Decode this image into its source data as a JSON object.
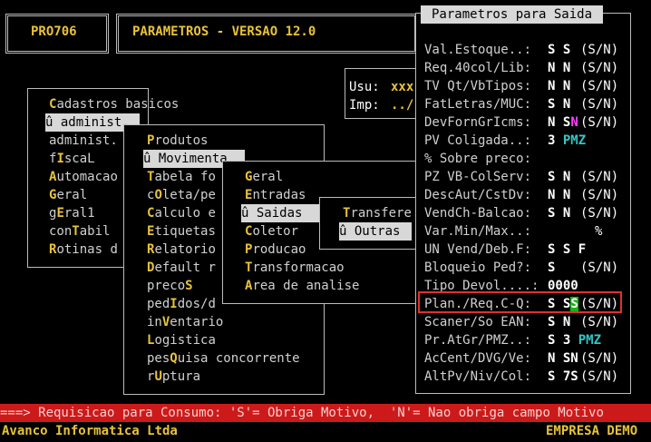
{
  "header": {
    "code": "PRO706",
    "title": "PARAMETROS - VERSAO 12.0"
  },
  "user_box": {
    "usu_label": "Usu:",
    "usu_value": "xxx",
    "imp_label": "Imp:",
    "imp_value": "../"
  },
  "menu1": {
    "items": [
      {
        "hot": "C",
        "rest": "adastros basicos"
      },
      {
        "prefix": "û ",
        "text": "administ.",
        "selected": true
      },
      {
        "text": "administ."
      },
      {
        "pre": "f",
        "hot": "I",
        "rest": "scaL"
      },
      {
        "hot": "A",
        "rest": "utomacao"
      },
      {
        "hot": "G",
        "rest": "eral"
      },
      {
        "pre": "g",
        "hot": "E",
        "rest": "ral1"
      },
      {
        "pre": "con",
        "hot": "T",
        "rest": "abil"
      },
      {
        "hot": "R",
        "rest": "otinas d"
      }
    ]
  },
  "menu2": {
    "items": [
      {
        "hot": "P",
        "rest": "rodutos"
      },
      {
        "prefix": "û ",
        "text": "Movimenta",
        "selected": true
      },
      {
        "hot": "T",
        "rest": "abela fo"
      },
      {
        "pre": "c",
        "hot": "O",
        "rest": "leta/pe"
      },
      {
        "hot": "C",
        "rest": "alculo e"
      },
      {
        "hot": "E",
        "rest": "tiquetas"
      },
      {
        "hot": "R",
        "rest": "elatorio"
      },
      {
        "hot": "D",
        "rest": "efault r"
      },
      {
        "pre": "preco",
        "hot": "S",
        "rest": ""
      },
      {
        "pre": "ped",
        "hot": "I",
        "rest": "dos/d"
      },
      {
        "pre": "in",
        "hot": "V",
        "rest": "entario"
      },
      {
        "hot": "L",
        "rest": "ogistica"
      },
      {
        "pre": "pes",
        "hot": "Q",
        "rest": "uisa concorrente"
      },
      {
        "pre": "r",
        "hot": "U",
        "rest": "ptura"
      }
    ]
  },
  "menu3": {
    "items": [
      {
        "hot": "G",
        "rest": "eral"
      },
      {
        "hot": "E",
        "rest": "ntradas"
      },
      {
        "prefix": "û ",
        "text": "Saidas",
        "selected": true
      },
      {
        "hot": "C",
        "rest": "oletor"
      },
      {
        "hot": "P",
        "rest": "roducao"
      },
      {
        "hot": "T",
        "rest": "ransformacao"
      },
      {
        "hot": "A",
        "rest": "rea de analise"
      }
    ]
  },
  "menu4": {
    "items": [
      {
        "hot": "T",
        "rest": "ransfere"
      },
      {
        "prefix": "û ",
        "text": "Outras",
        "selected": true
      }
    ]
  },
  "params": {
    "title": "Parametros para Saida",
    "rows": [
      {
        "label": "Val.Estoque..:",
        "v1": "S",
        "v2": "S",
        "v3": "",
        "hint": "(S/N)"
      },
      {
        "label": "Req.40col/Lib:",
        "v1": "N",
        "v2": "N",
        "v3": "",
        "hint": "(S/N)"
      },
      {
        "label": "TV Qt/VbTipos:",
        "v1": "N",
        "v2": "N",
        "v3": "",
        "hint": "(S/N)"
      },
      {
        "label": "FatLetras/MUC:",
        "v1": "S",
        "v2": "N",
        "v3": "",
        "hint": "(S/N)"
      },
      {
        "label": "DevFornGrIcms:",
        "v1": "N",
        "v2": "S",
        "v3": "N",
        "hint": "(S/N)"
      },
      {
        "label": "PV Coligada..:",
        "v1": "3",
        "v2": "PMZ",
        "v3": "",
        "hint": ""
      },
      {
        "label": "% Sobre preco:",
        "v1": "",
        "v2": "",
        "v3": "",
        "hint": ""
      },
      {
        "label": "PZ VB-ColServ:",
        "v1": "S",
        "v2": "N",
        "v3": "",
        "hint": "(S/N)"
      },
      {
        "label": "DescAut/CstDv:",
        "v1": "N",
        "v2": "N",
        "v3": "",
        "hint": "(S/N)"
      },
      {
        "label": "VendCh-Balcao:",
        "v1": "S",
        "v2": "N",
        "v3": "",
        "hint": "(S/N)"
      },
      {
        "label": "Var.Min/Max..:",
        "v1": "",
        "v2": "",
        "v3": "",
        "hint": "%"
      },
      {
        "label": "UN Vend/Deb.F:",
        "v1": "S",
        "v2": "S",
        "v3": "F",
        "hint": ""
      },
      {
        "label": "Bloqueio Ped?:",
        "v1": "S",
        "v2": "",
        "v3": "",
        "hint": "(S/N)"
      },
      {
        "label": "Tipo Devol....:",
        "v1": "0000",
        "v2": "",
        "v3": "",
        "hint": ""
      },
      {
        "label": "Plan./Req.C-Q:",
        "v1": "S",
        "v2": "S",
        "v3": "S",
        "hint": "(S/N)",
        "focused": true
      },
      {
        "label": "Scaner/So EAN:",
        "v1": "S",
        "v2": "N",
        "v3": "",
        "hint": "(S/N)"
      },
      {
        "label": "Pr.AtGr/PMZ..:",
        "v1": "S",
        "v2": "3",
        "v3": "PMZ",
        "hint": ""
      },
      {
        "label": "AcCent/DVG/Ve:",
        "v1": "N",
        "v2": "SN",
        "v3": "",
        "hint": "(S/N)"
      },
      {
        "label": "AltPv/Niv/Col:",
        "v1": "S",
        "v2": "7S",
        "v3": "",
        "hint": "(S/N)"
      }
    ]
  },
  "status_bar": {
    "text": "===> Requisicao para Consumo: 'S'= Obriga Motivo,  'N'= Nao obriga campo Motivo"
  },
  "footer": {
    "company": "Avanco Informatica Ltda",
    "empresa": "EMPRESA DEMO"
  },
  "colors": {
    "hotkey": "#e8c33a",
    "status_bg": "#cc1a1a",
    "focus_border": "#e03030",
    "accent_green": "#16b316",
    "accent_cyan": "#34c6c6",
    "accent_magenta": "#ff3dff"
  }
}
